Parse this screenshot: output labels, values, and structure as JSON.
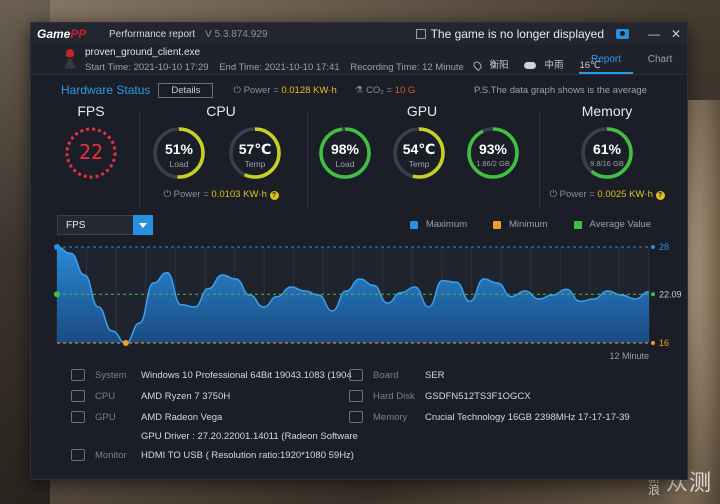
{
  "app": {
    "logo_main": "Game",
    "logo_accent": "PP",
    "title": "Performance report",
    "version": "V 5.3.874.929",
    "display_toggle": "The game is no longer displayed",
    "window_controls": [
      "—",
      "✕"
    ]
  },
  "game": {
    "exe": "proven_ground_client.exe",
    "start_time": "Start Time: 2021-10-10 17:29",
    "end_time": "End Time: 2021-10-10 17:41",
    "recording_time": "Recording Time: 12 Minute",
    "location": "衡阳",
    "weather": "中雨",
    "temperature": "16℃"
  },
  "tabs": [
    {
      "label": "Report",
      "active": true
    },
    {
      "label": "Chart",
      "active": false
    }
  ],
  "hardware": {
    "title": "Hardware Status",
    "details_label": "Details",
    "power_label": "Power = ",
    "power_value": "0.0128 KW·h",
    "co2_label": "CO₂ = ",
    "co2_value": "10 G",
    "ps_note": "P.S.The data graph shows is the average"
  },
  "panels": {
    "fps": {
      "title": "FPS",
      "value": "22"
    },
    "cpu": {
      "title": "CPU",
      "load_value": "51%",
      "load_label": "Load",
      "load_pct": 51,
      "temp_value": "57℃",
      "temp_label": "Temp",
      "temp_pct": 57,
      "power_label": "Power = ",
      "power_value": "0.0103 KW·h"
    },
    "gpu": {
      "title": "GPU",
      "load_value": "98%",
      "load_label": "Load",
      "load_pct": 98,
      "temp_value": "54℃",
      "temp_label": "Temp",
      "temp_pct": 54,
      "mem_value": "93%",
      "mem_label": "1.86/2 GB",
      "mem_pct": 93
    },
    "memory": {
      "title": "Memory",
      "value": "61%",
      "label": "9.8/16 GB",
      "pct": 61,
      "power_label": "Power = ",
      "power_value": "0.0025 KW·h"
    }
  },
  "chart_controls": {
    "selected_metric": "FPS",
    "legend": [
      {
        "name": "Maximum",
        "color": "#2a8fe0"
      },
      {
        "name": "Minimum",
        "color": "#f0a020"
      },
      {
        "name": "Average Value",
        "color": "#40c040"
      }
    ]
  },
  "chart_data": {
    "type": "area",
    "series_label": "FPS",
    "y_max_label": "28",
    "y_min_label": "16",
    "avg_label": "22.09",
    "max": 28,
    "min": 16,
    "average": 22.09,
    "ylim": [
      16,
      28
    ],
    "x_end_label": "12 Minute",
    "values": [
      28,
      27.2,
      24.5,
      20.5,
      17.5,
      16.0,
      18.5,
      23.5,
      24.8,
      20.8,
      20.5,
      22.8,
      24.5,
      24.0,
      22.0,
      20.5,
      21.8,
      23.0,
      22.5,
      22.0,
      20.0,
      22.5,
      24.0,
      23.2,
      21.0,
      22.3,
      23.0,
      20.5,
      23.8,
      23.6,
      21.2,
      24.0,
      23.5,
      21.8,
      22.5,
      21.5,
      22.0,
      22.7,
      21.2,
      21.5,
      22.5,
      22.0,
      21.5,
      22.4
    ]
  },
  "system": {
    "system_label": "System",
    "system_value": "Windows 10 Professional 64Bit   19043.1083 (1904",
    "cpu_label": "CPU",
    "cpu_value": "AMD Ryzen 7 3750H",
    "gpu_label": "GPU",
    "gpu_value": "AMD Radeon Vega",
    "gpu_driver": "GPU Driver : 27.20.22001.14011 (Radeon Software",
    "monitor_label": "Monitor",
    "monitor_value": "HDMI TO USB ( Resolution ratio:1920*1080 59Hz)",
    "board_label": "Board",
    "board_value": "SER",
    "disk_label": "Hard Disk",
    "disk_value": "GSDFN512TS3F1OGCX",
    "memory_label": "Memory",
    "memory_value": "Crucial Technology 16GB 2398MHz 17-17-17-39"
  },
  "watermark": {
    "top": "新",
    "bottom": "浪",
    "big": "众测"
  }
}
